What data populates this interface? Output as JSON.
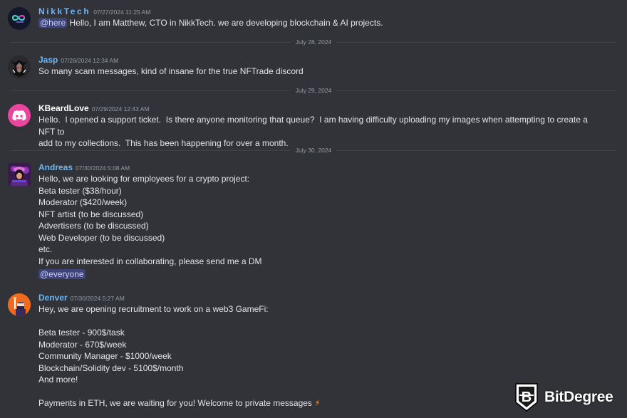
{
  "messages": [
    {
      "author": "NikkTech",
      "timestamp": "07/27/2024 11:25 AM",
      "mention": "@here",
      "lines": [
        "Hello, I am Matthew, CTO in NikkTech. we are developing blockchain & AI projects."
      ],
      "avatar_icon": "nikktech-infinity-logo",
      "author_color": "#6fb7f4"
    },
    {
      "author": "Jasp",
      "timestamp": "07/28/2024 12:34 AM",
      "lines": [
        "So many scam messages, kind of insane for the true NFTrade discord"
      ],
      "avatar_icon": "dark-creature-avatar",
      "author_color": "#6fb7f4"
    },
    {
      "author": "KBeardLove",
      "timestamp": "07/29/2024 12:43 AM",
      "lines": [
        "Hello.  I opened a support ticket.  Is there anyone monitoring that queue?  I am having difficulty uploading my images when attempting to create a NFT to",
        "add to my collections.  This has been happening for over a month."
      ],
      "avatar_icon": "discord-logo",
      "author_color": "#ffffff"
    },
    {
      "author": "Andreas",
      "timestamp": "07/30/2024 5:08 AM",
      "lines": [
        "Hello, we are looking for employees for a crypto project:",
        "Beta tester ($38/hour)",
        "Moderator ($420/week)",
        "NFT artist (to be discussed)",
        "Advertisers (to be discussed)",
        "Web Developer (to be discussed)",
        "etc.",
        "If you are interested in collaborating, please send me a DM"
      ],
      "mention_after": "@everyone",
      "avatar_icon": "purple-anime-avatar",
      "author_color": "#6fb7f4"
    },
    {
      "author": "Denver",
      "timestamp": "07/30/2024 5:27 AM",
      "lines": [
        "Hey, we are opening recruitment to work on a web3 GameFi:",
        "",
        "Beta tester - 900$/task",
        "Moderator - 670$/week",
        "Community Manager - $1000/week",
        "Blockchain/Solidity dev - 5100$/month",
        "And more!",
        "",
        "Payments in ETH, we are waiting for you! Welcome to private messages"
      ],
      "trailing_emoji": "⚡",
      "avatar_icon": "orange-pixel-avatar",
      "author_color": "#6fb7f4"
    }
  ],
  "dividers": [
    "July 28, 2024",
    "July 29, 2024",
    "July 30, 2024"
  ],
  "watermark": {
    "text": "BitDegree",
    "icon": "bitdegree-shield-logo"
  }
}
